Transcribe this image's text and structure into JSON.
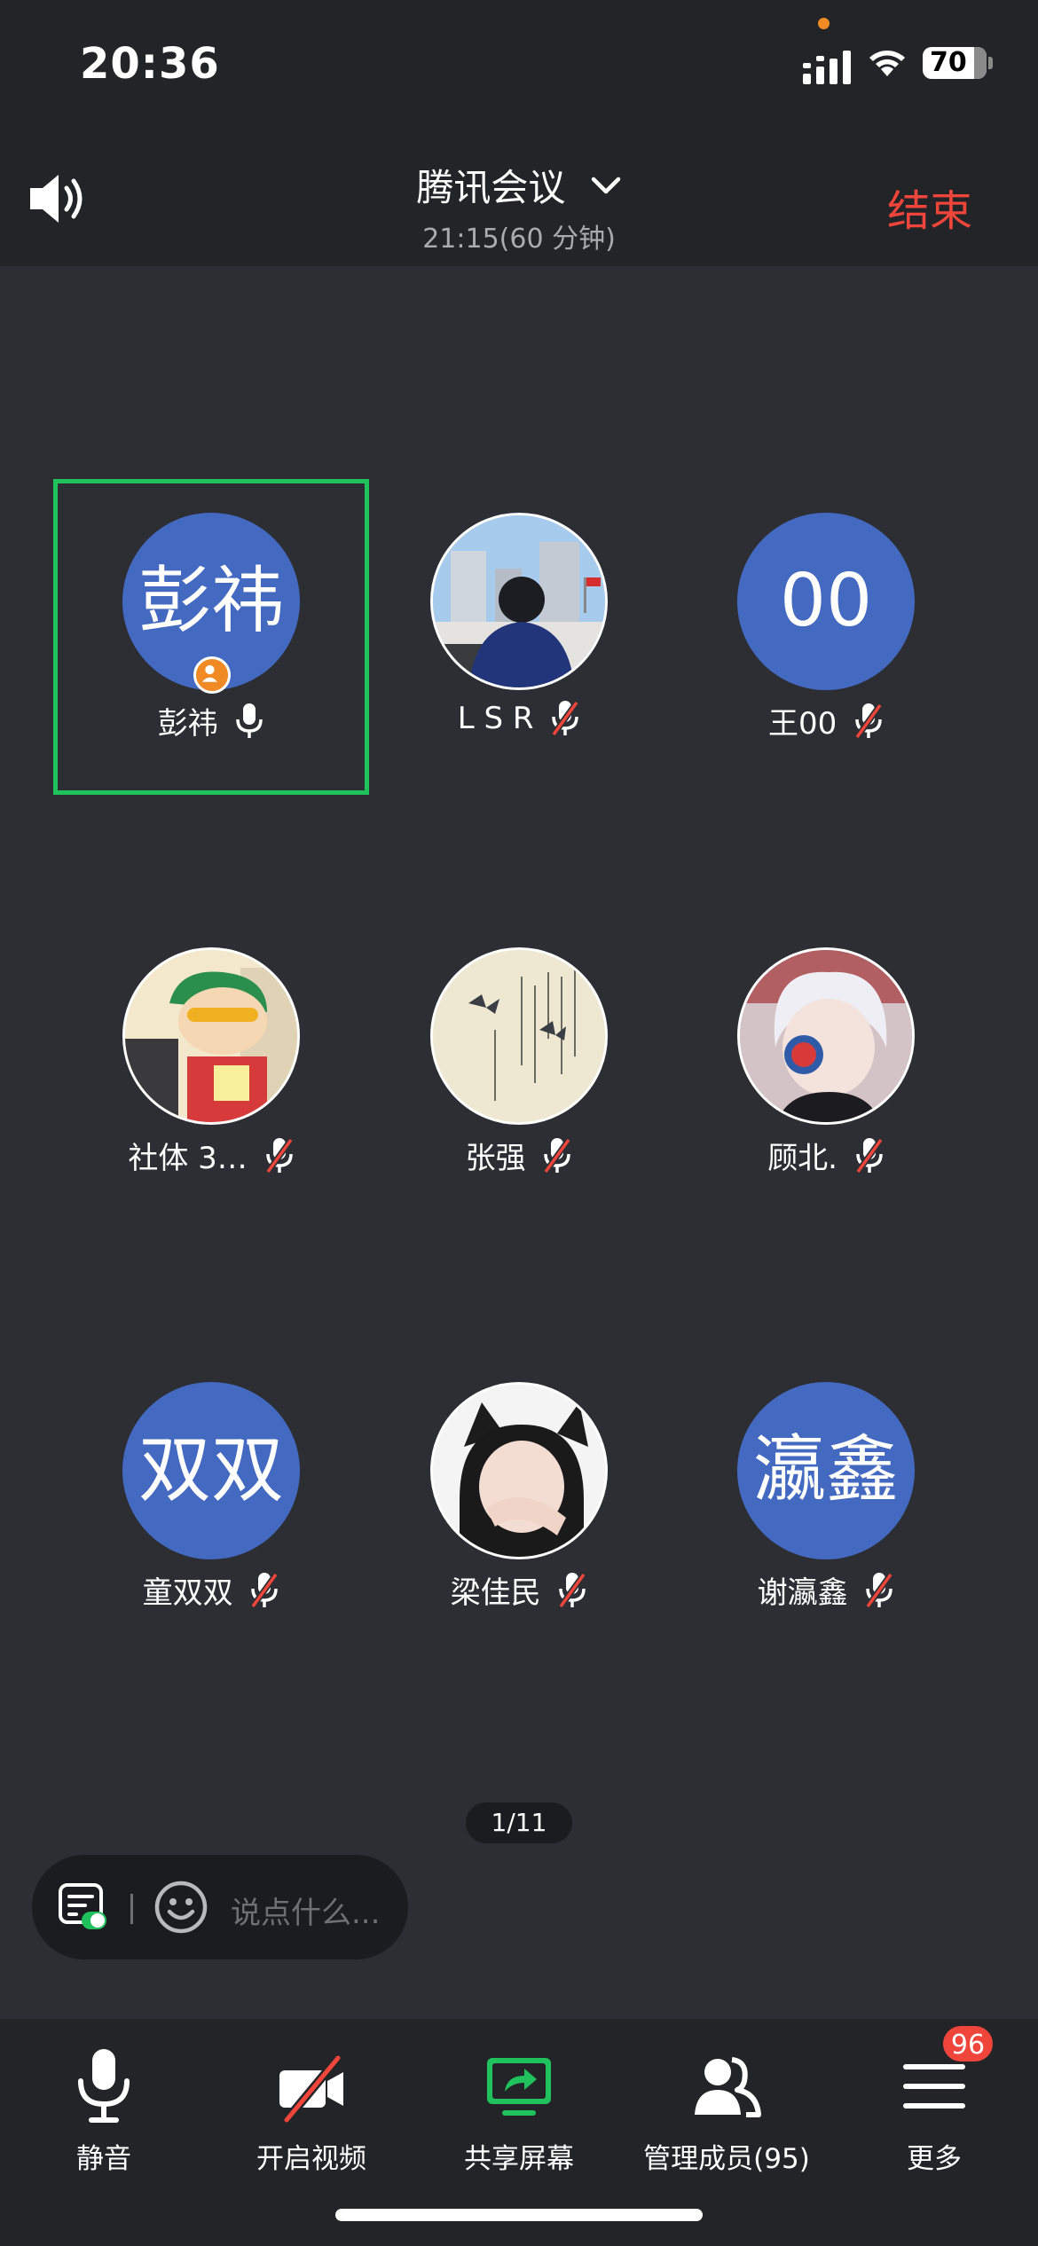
{
  "status_bar": {
    "time": "20:36",
    "battery": "70",
    "icons": [
      "signal-icon",
      "wifi-icon",
      "battery-icon"
    ]
  },
  "header": {
    "speaker_icon": "speaker-icon",
    "title": "腾讯会议",
    "subtitle": "21:15(60 分钟)",
    "end_label": "结束",
    "end_color": "#f0453b"
  },
  "participants": [
    {
      "avatar_text": "彭祎",
      "name": "彭祎",
      "mic": "on",
      "host": true,
      "active_speaker": true
    },
    {
      "avatar_text": "",
      "name": "L S R",
      "mic": "muted",
      "avatar": "photo-man-city"
    },
    {
      "avatar_text": "00",
      "name": "王00",
      "mic": "muted"
    },
    {
      "avatar_text": "",
      "name": "社体 3…",
      "mic": "muted",
      "avatar": "photo-cartoon-boy"
    },
    {
      "avatar_text": "",
      "name": "张强",
      "mic": "muted",
      "avatar": "photo-calligraphy-butterflies"
    },
    {
      "avatar_text": "",
      "name": "顾北.",
      "mic": "muted",
      "avatar": "photo-anime-boy"
    },
    {
      "avatar_text": "双双",
      "name": "童双双",
      "mic": "muted"
    },
    {
      "avatar_text": "",
      "name": "梁佳民",
      "mic": "muted",
      "avatar": "photo-girl-cat-ears"
    },
    {
      "avatar_text": "瀛鑫",
      "name": "谢瀛鑫",
      "mic": "muted"
    }
  ],
  "pager": "1/11",
  "chat": {
    "placeholder": "说点什么..."
  },
  "toolbar": {
    "items": [
      {
        "label": "静音",
        "icon": "microphone-icon"
      },
      {
        "label": "开启视频",
        "icon": "camera-off-icon"
      },
      {
        "label": "共享屏幕",
        "icon": "share-screen-icon"
      },
      {
        "label": "管理成员(95)",
        "icon": "members-icon"
      },
      {
        "label": "更多",
        "icon": "menu-icon"
      }
    ],
    "more_badge": "96"
  },
  "colors": {
    "accent_green": "#1fc25c",
    "avatar_blue": "#4369c1",
    "host_orange": "#f08a24",
    "danger_red": "#f0453b"
  }
}
